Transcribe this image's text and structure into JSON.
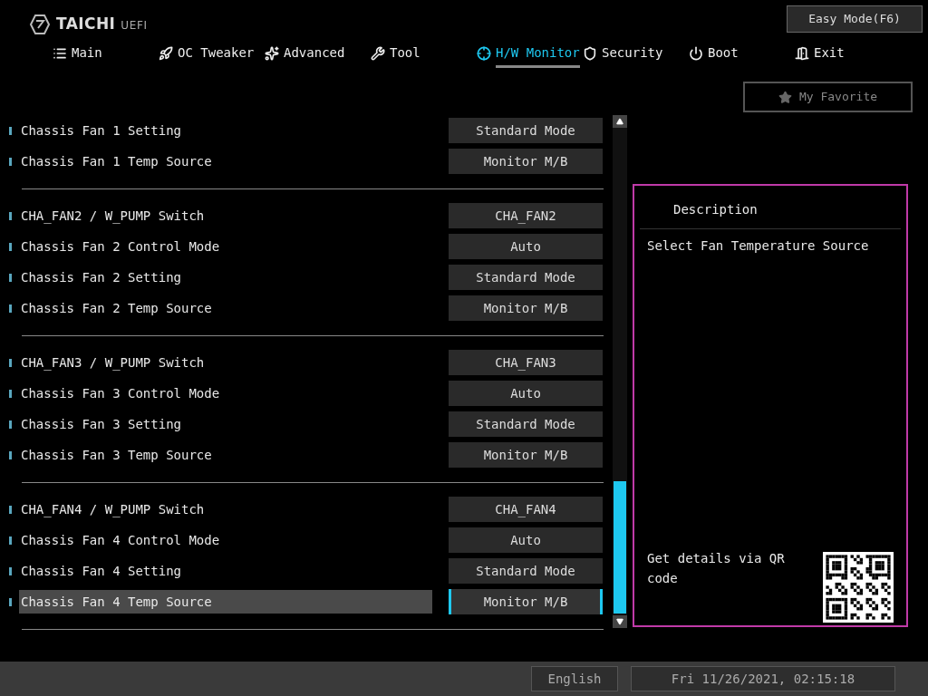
{
  "header": {
    "brand": "TAICHI",
    "suffix": "UEFI",
    "easy_mode_button": "Easy Mode(F6)"
  },
  "tabs": [
    {
      "label": "Main",
      "selected": false
    },
    {
      "label": "OC Tweaker",
      "selected": false
    },
    {
      "label": "Advanced",
      "selected": false
    },
    {
      "label": "Tool",
      "selected": false
    },
    {
      "label": "H/W Monitor",
      "selected": true
    },
    {
      "label": "Security",
      "selected": false
    },
    {
      "label": "Boot",
      "selected": false
    },
    {
      "label": "Exit",
      "selected": false
    }
  ],
  "my_favorite_button": "My Favorite",
  "groups": [
    {
      "rows": [
        {
          "label": "Chassis Fan 1 Setting",
          "value": "Standard Mode",
          "selected": false
        },
        {
          "label": "Chassis Fan 1 Temp Source",
          "value": "Monitor M/B",
          "selected": false
        }
      ]
    },
    {
      "rows": [
        {
          "label": "CHA_FAN2 / W_PUMP Switch",
          "value": "CHA_FAN2",
          "selected": false
        },
        {
          "label": "Chassis Fan 2 Control Mode",
          "value": "Auto",
          "selected": false
        },
        {
          "label": "Chassis Fan 2 Setting",
          "value": "Standard Mode",
          "selected": false
        },
        {
          "label": "Chassis Fan 2 Temp Source",
          "value": "Monitor M/B",
          "selected": false
        }
      ]
    },
    {
      "rows": [
        {
          "label": "CHA_FAN3 / W_PUMP Switch",
          "value": "CHA_FAN3",
          "selected": false
        },
        {
          "label": "Chassis Fan 3 Control Mode",
          "value": "Auto",
          "selected": false
        },
        {
          "label": "Chassis Fan 3 Setting",
          "value": "Standard Mode",
          "selected": false
        },
        {
          "label": "Chassis Fan 3 Temp Source",
          "value": "Monitor M/B",
          "selected": false
        }
      ]
    },
    {
      "rows": [
        {
          "label": "CHA_FAN4 / W_PUMP Switch",
          "value": "CHA_FAN4",
          "selected": false
        },
        {
          "label": "Chassis Fan 4 Control Mode",
          "value": "Auto",
          "selected": false
        },
        {
          "label": "Chassis Fan 4 Setting",
          "value": "Standard Mode",
          "selected": false
        },
        {
          "label": "Chassis Fan 4 Temp Source",
          "value": "Monitor M/B",
          "selected": true
        }
      ]
    }
  ],
  "description": {
    "title": "Description",
    "text": "Select Fan Temperature Source",
    "qr_text": "Get details via QR code"
  },
  "footer": {
    "language": "English",
    "datetime": "Fri 11/26/2021, 02:15:18"
  }
}
